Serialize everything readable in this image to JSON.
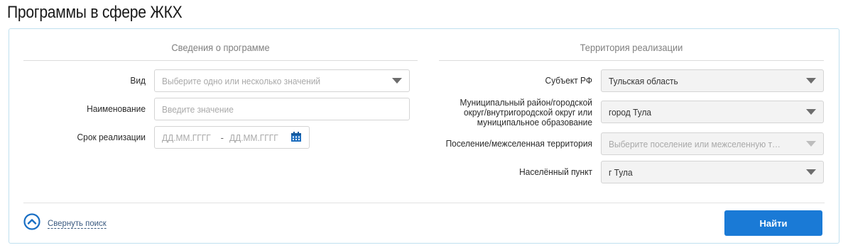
{
  "page_title": "Программы в сфере ЖКХ",
  "left_section": {
    "title": "Сведения о программе",
    "fields": {
      "type": {
        "label": "Вид",
        "placeholder": "Выберите одно или несколько значений"
      },
      "name": {
        "label": "Наименование",
        "placeholder": "Введите значение"
      },
      "period": {
        "label": "Срок реализации",
        "from_placeholder": "ДД.ММ.ГГГГ",
        "separator": "-",
        "to_placeholder": "ДД.ММ.ГГГГ"
      }
    }
  },
  "right_section": {
    "title": "Территория реализации",
    "fields": {
      "subject": {
        "label": "Субъект РФ",
        "value": "Тульская область"
      },
      "municipal": {
        "label_lines": [
          "Муниципальный район/городской",
          "округ/внутригородской округ или",
          "муниципальное образование"
        ],
        "value": "город Тула"
      },
      "settlement": {
        "label": "Поселение/межселенная территория",
        "placeholder": "Выберите поселение или межселенную терр…"
      },
      "locality": {
        "label": "Населённый пункт",
        "value": "г Тула"
      }
    }
  },
  "actions": {
    "collapse_label": "Свернуть поиск",
    "find_label": "Найти"
  },
  "colors": {
    "accent": "#1a7ad6",
    "panel_border": "#bfe0ef",
    "link": "#3a5a80"
  },
  "icons": {
    "collapse": "chevron-up-circle-icon",
    "calendar": "calendar-icon",
    "dropdown": "caret-down-icon"
  }
}
